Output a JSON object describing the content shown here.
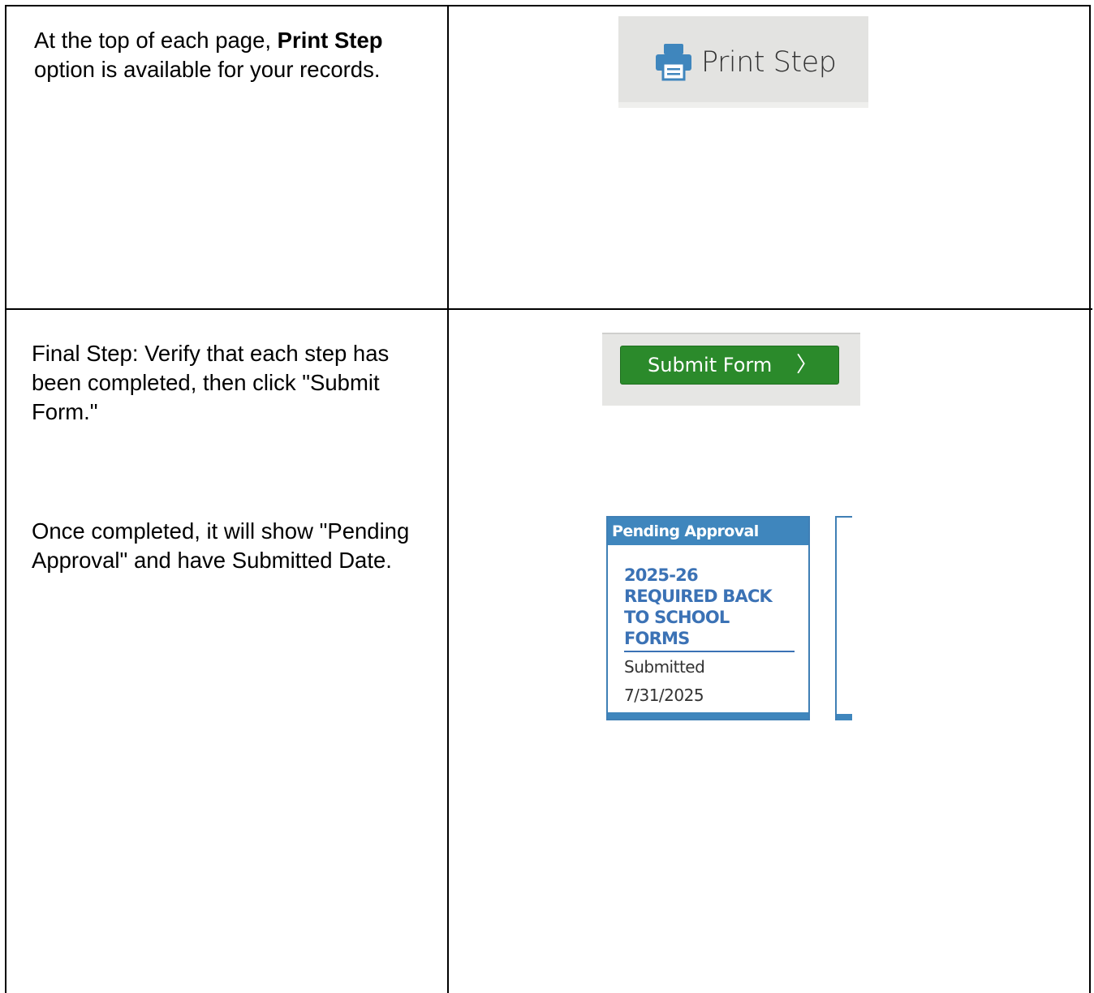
{
  "row1": {
    "text_prefix": "At the top of each page, ",
    "text_bold": "Print Step",
    "text_suffix": " option is available for your records.",
    "print_button_label": "Print Step"
  },
  "row2": {
    "instruction": "Final Step:  Verify that each step has been completed, then click \"Submit Form.\"",
    "submit_button_label": "Submit Form",
    "completion_note": "Once completed, it will show \"Pending Approval\" and have Submitted Date.",
    "card": {
      "status": "Pending Approval",
      "title": "2025-26 REQUIRED BACK TO SCHOOL FORMS",
      "submitted_label": "Submitted",
      "submitted_date": "7/31/2025"
    }
  },
  "colors": {
    "accent_blue": "#3f86bd",
    "link_blue": "#3b72b5",
    "submit_green": "#2b8a2b",
    "panel_gray": "#e3e3e1"
  },
  "icons": {
    "print": "printer-icon",
    "submit": "chevron-right-icon"
  }
}
